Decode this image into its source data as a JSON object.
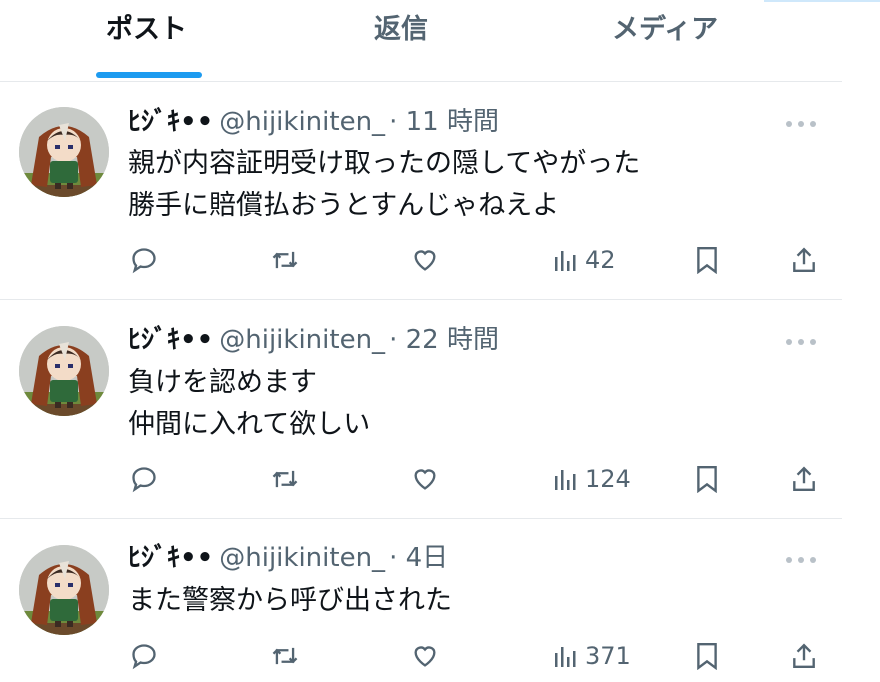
{
  "tabs": [
    {
      "label": "ポスト",
      "active": true
    },
    {
      "label": "返信",
      "active": false
    },
    {
      "label": "メディア",
      "active": false
    }
  ],
  "colors": {
    "accent": "#1d9bf0",
    "text": "#0f1419",
    "muted": "#536471",
    "divider": "#e6e9ec"
  },
  "posts": [
    {
      "display_name": "ﾋｼﾞｷ••",
      "handle": "@hijikiniten_",
      "time": "· 11 時間",
      "lines": [
        "親が内容証明受け取ったの隠してやがった",
        "勝手に賠償払おうとすんじゃねえよ"
      ],
      "views": "42"
    },
    {
      "display_name": "ﾋｼﾞｷ••",
      "handle": "@hijikiniten_",
      "time": "· 22 時間",
      "lines": [
        "負けを認めます",
        "仲間に入れて欲しい"
      ],
      "views": "124"
    },
    {
      "display_name": "ﾋｼﾞｷ••",
      "handle": "@hijikiniten_",
      "time": "· 4日",
      "lines": [
        "また警察から呼び出された"
      ],
      "views": "371"
    }
  ],
  "icons": [
    "reply-icon",
    "repost-icon",
    "like-icon",
    "views-icon",
    "bookmark-icon",
    "share-icon",
    "more-icon"
  ]
}
